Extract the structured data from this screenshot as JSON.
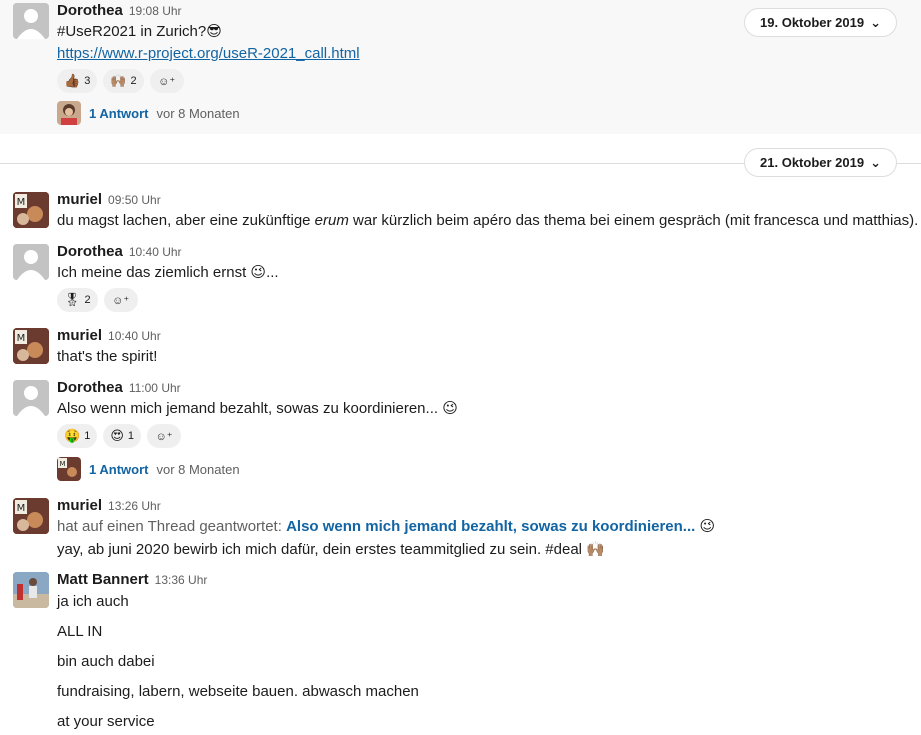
{
  "colors": {
    "link": "#1264a3",
    "meta": "#616061",
    "text": "#1d1c1d",
    "highlight": "#f8f8f8",
    "pill_border": "#dddddd"
  },
  "date_dividers": [
    {
      "label": "19. Oktober 2019",
      "icon": "chevron-down-icon"
    },
    {
      "label": "21. Oktober 2019",
      "icon": "chevron-down-icon"
    }
  ],
  "messages": [
    {
      "author": "Dorothea",
      "time": "19:08 Uhr",
      "text1": "#UseR2021 in Zurich?",
      "text1_emoji": "sunglasses-emoji",
      "link": "https://www.r-project.org/useR-2021_call.html",
      "reactions": [
        {
          "icon": "thumbsup-emoji",
          "count": "3"
        },
        {
          "icon": "raised-hands-emoji",
          "count": "2"
        }
      ],
      "thread": {
        "count": "1 Antwort",
        "time": "vor 8 Monaten"
      }
    },
    {
      "author": "muriel",
      "time": "09:50 Uhr",
      "text_pre": "du magst lachen, aber eine zukünftige ",
      "text_em": "erum",
      "text_post": " war kürzlich beim apéro das thema bei einem gespräch (mit francesca und matthias)."
    },
    {
      "author": "Dorothea",
      "time": "10:40 Uhr",
      "text": "Ich meine das ziemlich ernst",
      "text_tail": "...",
      "reactions": [
        {
          "icon": "medal-emoji",
          "count": "2"
        }
      ]
    },
    {
      "author": "muriel",
      "time": "10:40 Uhr",
      "text": "that's the spirit!"
    },
    {
      "author": "Dorothea",
      "time": "11:00 Uhr",
      "text": "Also wenn mich jemand bezahlt, sowas zu koordinieren...",
      "reactions": [
        {
          "icon": "money-mouth-emoji",
          "count": "1"
        },
        {
          "icon": "heart-eyes-emoji",
          "count": "1"
        }
      ],
      "thread": {
        "count": "1 Antwort",
        "time": "vor 8 Monaten"
      }
    },
    {
      "author": "muriel",
      "time": "13:26 Uhr",
      "reply_prefix": "hat auf einen Thread geantwortet: ",
      "reply_link": "Also wenn mich jemand bezahlt, sowas zu koordinieren...",
      "text": "yay, ab juni 2020 bewirb ich mich dafür, dein erstes teammitglied zu sein. #deal"
    },
    {
      "author": "Matt Bannert",
      "time": "13:36 Uhr",
      "lines": [
        "ja ich auch",
        "ALL IN",
        "bin auch dabei",
        "fundraising, labern, webseite bauen. abwasch machen",
        "at your service"
      ]
    }
  ]
}
